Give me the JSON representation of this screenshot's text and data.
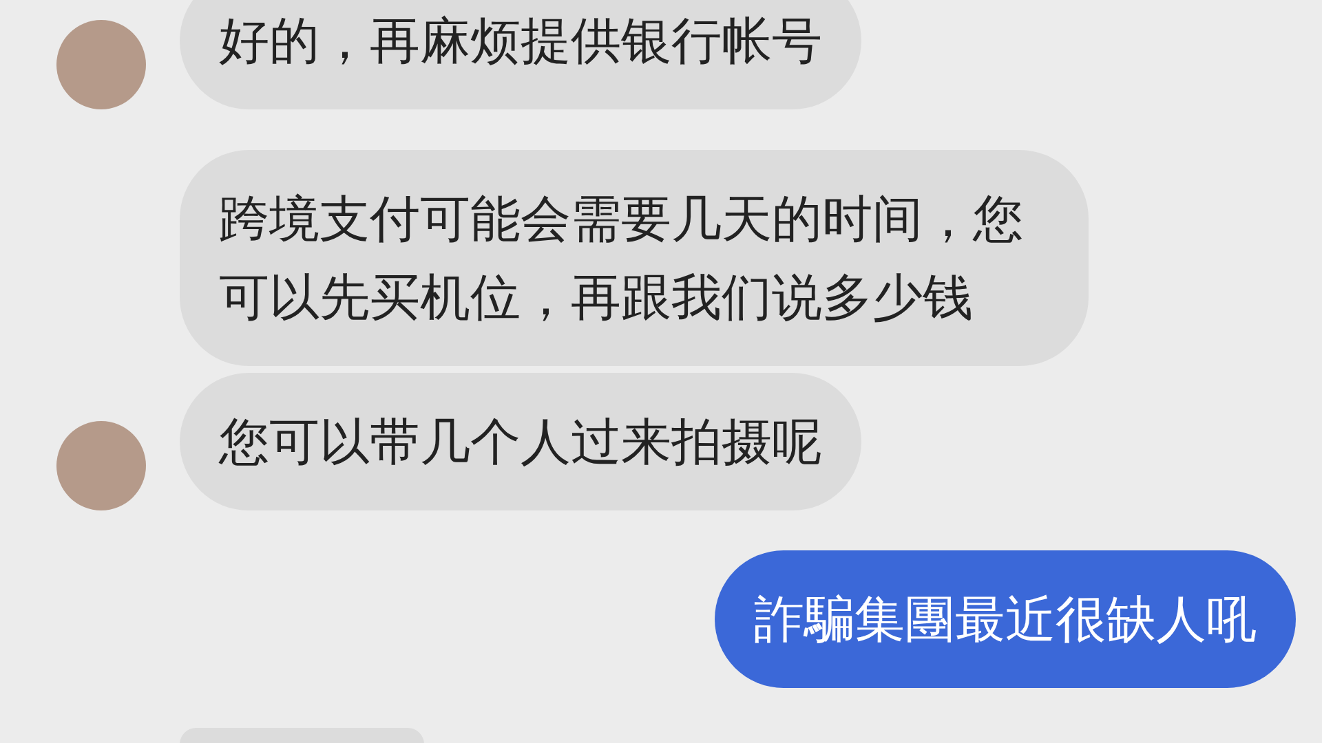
{
  "messages": [
    {
      "kind": "incoming",
      "avatar": true,
      "text": "好的，再麻烦提供银行帐号"
    },
    {
      "kind": "incoming",
      "avatar": false,
      "text": "跨境支付可能会需要几天的时间，您可以先买机位，再跟我们说多少钱"
    },
    {
      "kind": "incoming",
      "avatar": true,
      "text": "您可以带几个人过来拍摄呢"
    },
    {
      "kind": "outgoing",
      "text": "詐騙集團最近很缺人吼"
    },
    {
      "kind": "incoming",
      "avatar": false
    }
  ]
}
